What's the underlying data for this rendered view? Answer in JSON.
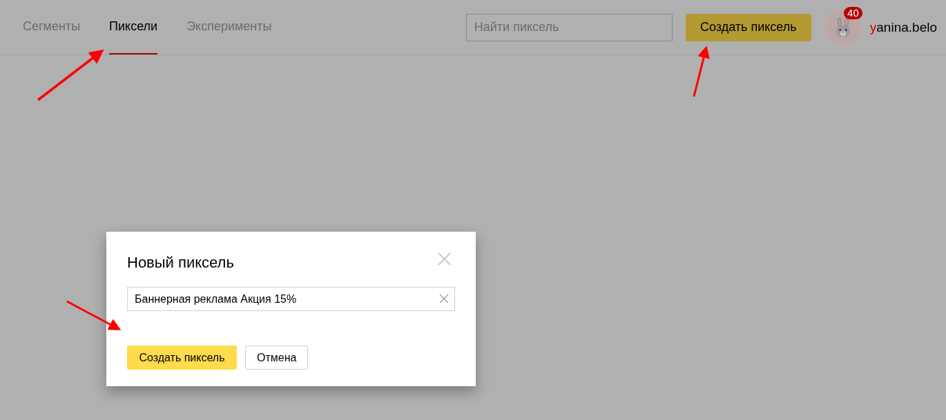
{
  "tabs": [
    {
      "label": "Сегменты",
      "selected": false
    },
    {
      "label": "Пиксели",
      "selected": true
    },
    {
      "label": "Эксперименты",
      "selected": false
    }
  ],
  "search": {
    "placeholder": "Найти пиксель"
  },
  "create_button": "Создать пиксель",
  "user": {
    "badge": "40",
    "username": "yanina.belo"
  },
  "dialog": {
    "title": "Новый пиксель",
    "input_value": "Баннерная реклама Акция 15%",
    "buttons": [
      {
        "label": "Создать пиксель",
        "kind": "primary"
      },
      {
        "label": "Отмена",
        "kind": "secondary"
      }
    ]
  }
}
